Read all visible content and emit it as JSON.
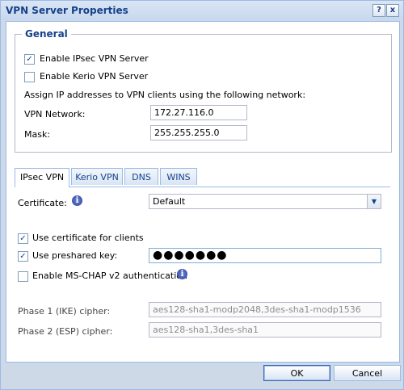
{
  "window": {
    "title": "VPN Server Properties",
    "help_glyph": "?",
    "close_glyph": "x"
  },
  "general": {
    "legend": "General",
    "enable_ipsec": {
      "label": "Enable IPsec VPN Server",
      "checked": true
    },
    "enable_kerio": {
      "label": "Enable Kerio VPN Server",
      "checked": false
    },
    "assign_text": "Assign IP addresses to VPN clients using the following network:",
    "vpn_network": {
      "label": "VPN Network:",
      "value": "172.27.116.0"
    },
    "mask": {
      "label": "Mask:",
      "value": "255.255.255.0"
    }
  },
  "tabs": [
    {
      "label": "IPsec VPN",
      "active": true
    },
    {
      "label": "Kerio VPN",
      "active": false
    },
    {
      "label": "DNS",
      "active": false
    },
    {
      "label": "WINS",
      "active": false
    }
  ],
  "ipsec": {
    "certificate": {
      "label": "Certificate:",
      "value": "Default",
      "info_glyph": "i"
    },
    "use_cert_clients": {
      "label": "Use certificate for clients",
      "checked": true
    },
    "use_preshared": {
      "label": "Use preshared key:",
      "checked": true,
      "value": "●●●●●●●"
    },
    "ms_chap": {
      "label": "Enable MS-CHAP v2 authentication",
      "checked": false,
      "info_glyph": "i"
    },
    "phase1": {
      "label": "Phase 1 (IKE) cipher:",
      "value": "aes128-sha1-modp2048,3des-sha1-modp1536"
    },
    "phase2": {
      "label": "Phase 2 (ESP) cipher:",
      "value": "aes128-sha1,3des-sha1"
    }
  },
  "buttons": {
    "ok": "OK",
    "cancel": "Cancel"
  },
  "check_glyph": "✓"
}
